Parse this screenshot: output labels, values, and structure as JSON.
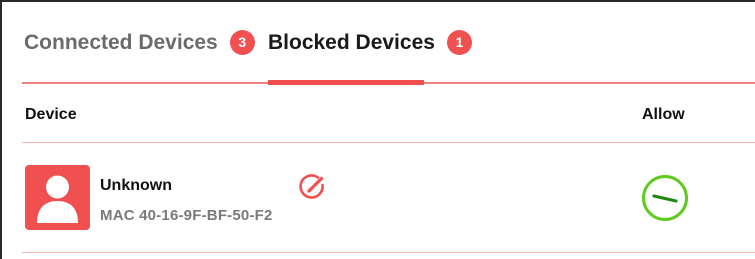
{
  "tabs": [
    {
      "label": "Connected Devices",
      "count": "3",
      "active": false
    },
    {
      "label": "Blocked Devices",
      "count": "1",
      "active": true
    }
  ],
  "table": {
    "columns": {
      "device": "Device",
      "allow": "Allow"
    },
    "rows": [
      {
        "name": "Unknown",
        "mac": "MAC 40-16-9F-BF-50-F2",
        "avatar_icon": "person-icon",
        "edit_icon": "edit-pencil-icon",
        "allow_icon": "blocked-toggle-icon"
      }
    ]
  },
  "colors": {
    "accent": "#f0504f",
    "allow_green": "#5ecb1e",
    "divider": "#f4b4b4"
  }
}
